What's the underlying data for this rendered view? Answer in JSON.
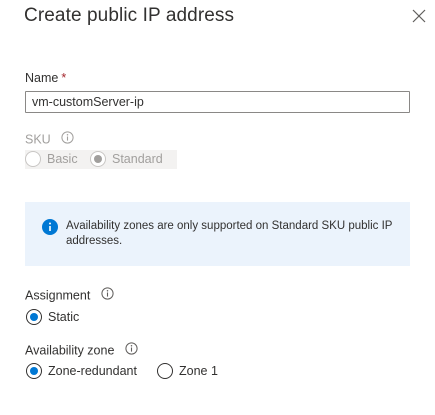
{
  "dialog": {
    "title": "Create public IP address"
  },
  "name_field": {
    "label": "Name",
    "required_mark": "*",
    "value": "vm-customServer-ip"
  },
  "sku": {
    "label": "SKU",
    "options": [
      {
        "label": "Basic",
        "checked": false
      },
      {
        "label": "Standard",
        "checked": true
      }
    ]
  },
  "info_banner": {
    "icon": "info-icon",
    "text": "Availability zones are only supported on Standard SKU public IP addresses."
  },
  "assignment": {
    "label": "Assignment",
    "options": [
      {
        "label": "Static",
        "checked": true
      }
    ]
  },
  "availability_zone": {
    "label": "Availability zone",
    "options": [
      {
        "label": "Zone-redundant",
        "checked": true
      },
      {
        "label": "Zone 1",
        "checked": false
      }
    ]
  },
  "colors": {
    "accent": "#0078d4",
    "info_background": "#ebf3fc",
    "required": "#a4262c"
  }
}
